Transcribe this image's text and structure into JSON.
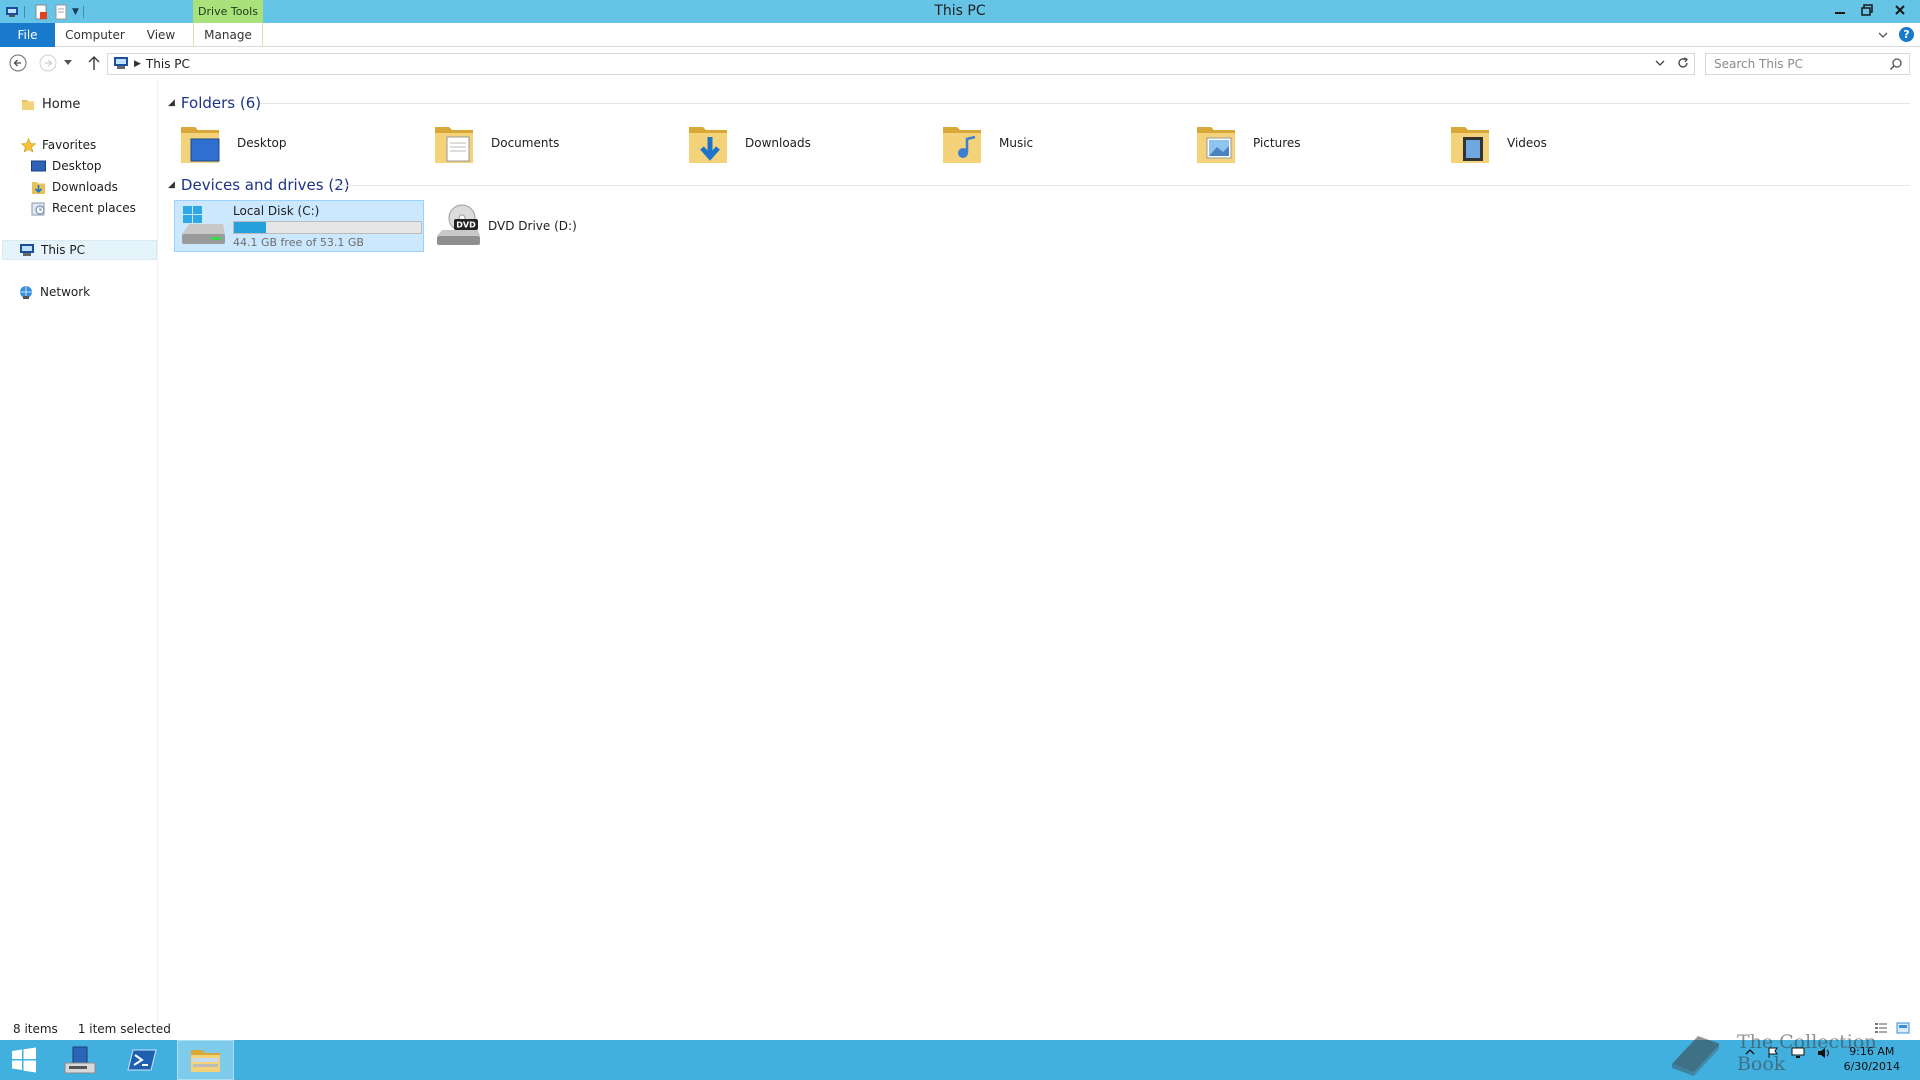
{
  "window": {
    "title": "This PC",
    "contextual_tab": "Drive Tools"
  },
  "ribbon": {
    "tabs": [
      "File",
      "Computer",
      "View",
      "Manage"
    ]
  },
  "address": {
    "location": "This PC",
    "search_placeholder": "Search This PC"
  },
  "nav": {
    "home": "Home",
    "favorites": "Favorites",
    "favorite_items": [
      "Desktop",
      "Downloads",
      "Recent places"
    ],
    "this_pc": "This PC",
    "network": "Network"
  },
  "folders": {
    "header": "Folders (6)",
    "items": [
      {
        "label": "Desktop",
        "icon": "desktop-folder-icon"
      },
      {
        "label": "Documents",
        "icon": "documents-folder-icon"
      },
      {
        "label": "Downloads",
        "icon": "downloads-folder-icon"
      },
      {
        "label": "Music",
        "icon": "music-folder-icon"
      },
      {
        "label": "Pictures",
        "icon": "pictures-folder-icon"
      },
      {
        "label": "Videos",
        "icon": "videos-folder-icon"
      }
    ]
  },
  "drives": {
    "header": "Devices and drives (2)",
    "local_disk": {
      "name": "Local Disk (C:)",
      "free_text": "44.1 GB free of 53.1 GB",
      "used_fraction": 0.17
    },
    "dvd": {
      "name": "DVD Drive (D:)",
      "badge": "DVD"
    }
  },
  "status": {
    "item_count": "8 items",
    "selection": "1 item selected"
  },
  "taskbar": {
    "time": "9:16 AM",
    "date": "6/30/2014"
  },
  "watermark": "The Collection Book",
  "colors": {
    "titlebar": "#66c4e6",
    "file_tab": "#1979ca",
    "taskbar": "#42b0df",
    "selection": "#cce8ff",
    "drive_bar": "#26a0da",
    "group_header": "#1e3287"
  }
}
